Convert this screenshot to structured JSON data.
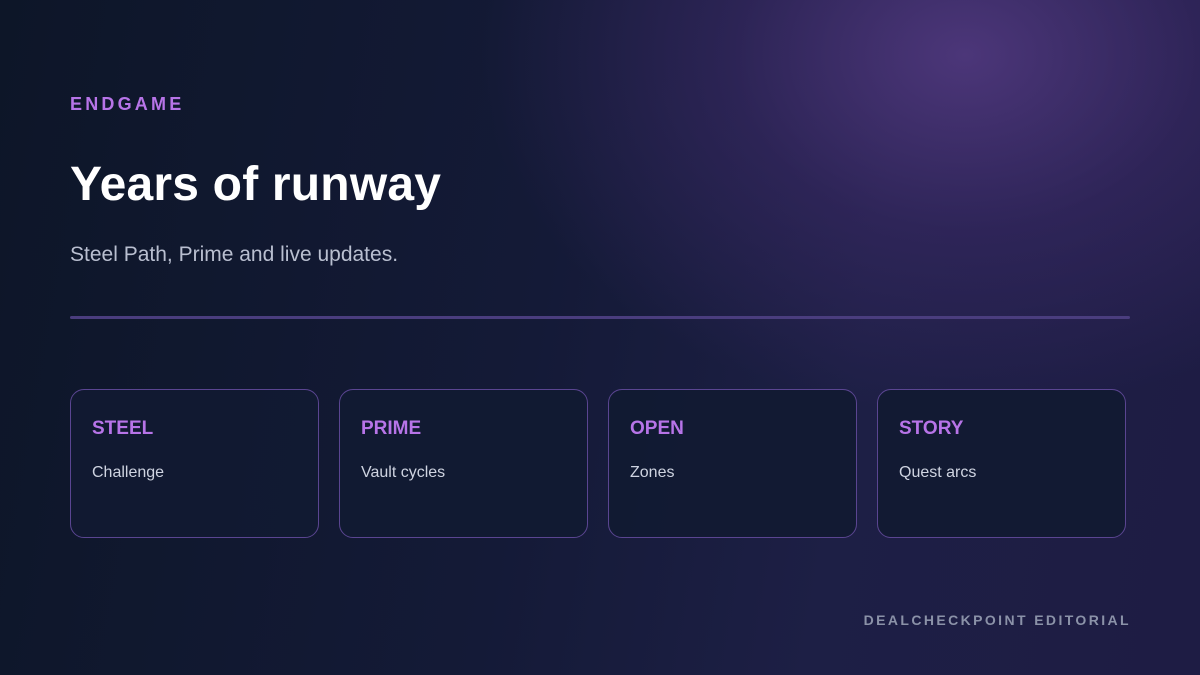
{
  "header": {
    "eyebrow": "ENDGAME",
    "title": "Years of runway",
    "subtitle": "Steel Path, Prime and live updates."
  },
  "cards": [
    {
      "title": "STEEL",
      "text": "Challenge"
    },
    {
      "title": "PRIME",
      "text": "Vault cycles"
    },
    {
      "title": "OPEN",
      "text": "Zones"
    },
    {
      "title": "STORY",
      "text": "Quest arcs"
    }
  ],
  "footer": {
    "credit": "DEALCHECKPOINT EDITORIAL"
  },
  "colors": {
    "accent": "#b774e8",
    "title": "#ffffff",
    "card_border": "#5a4591",
    "background": "#0f1729"
  }
}
